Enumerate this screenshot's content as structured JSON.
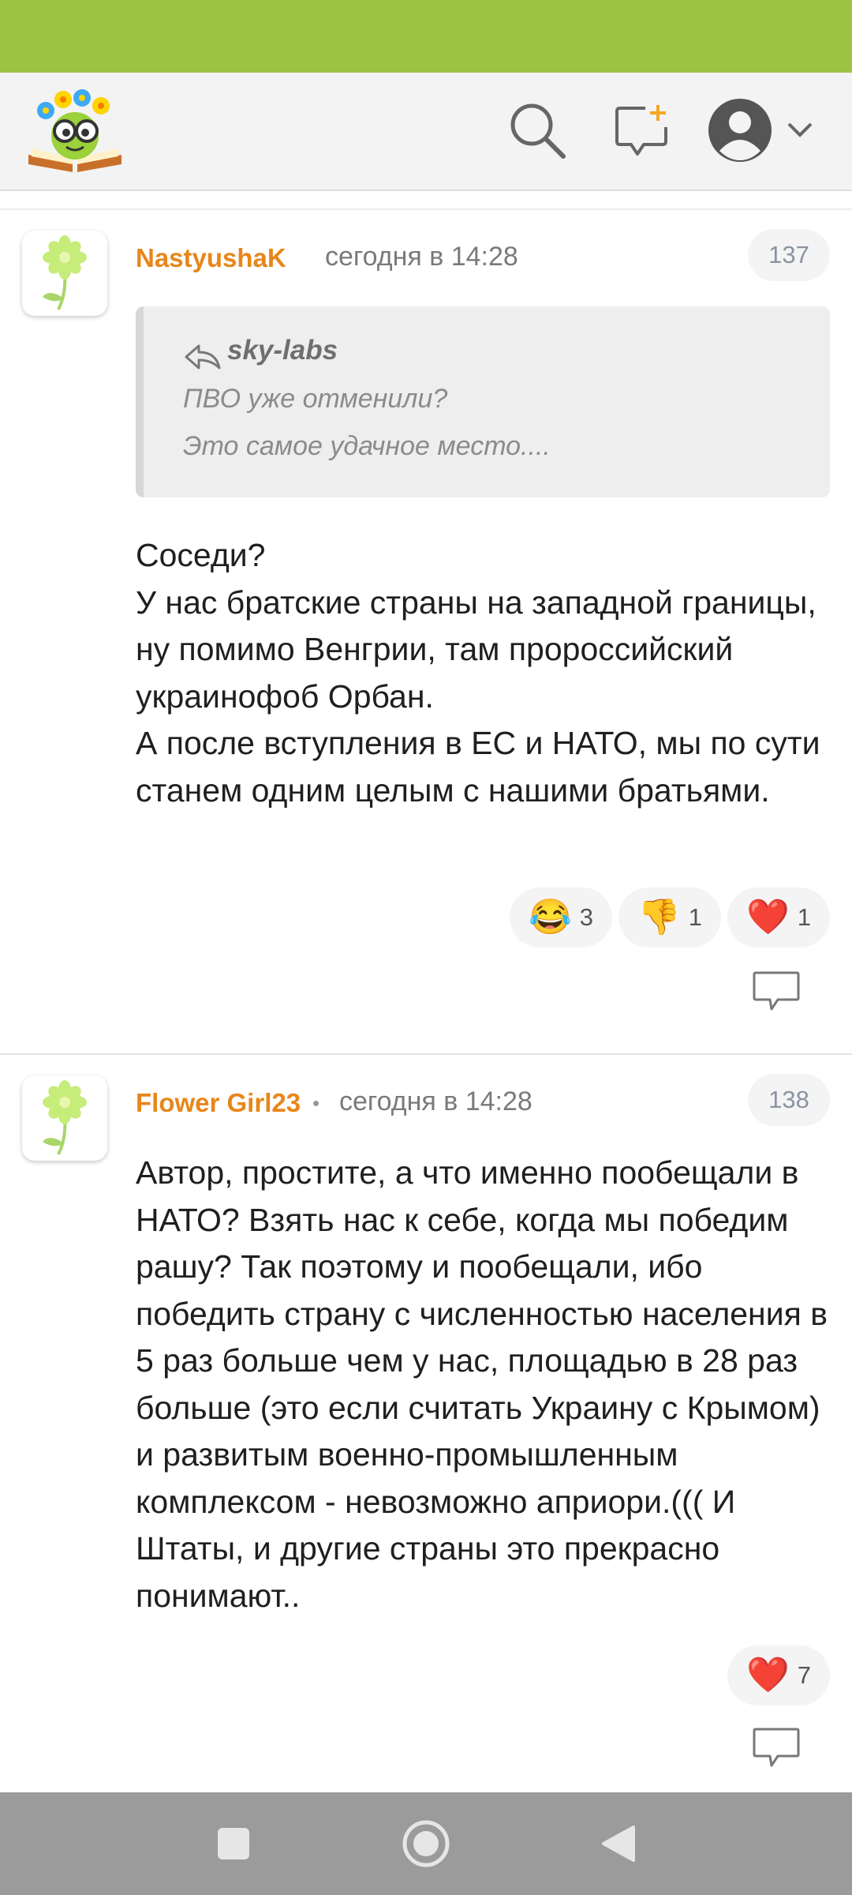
{
  "colors": {
    "status_bar": "#9dc244",
    "author": "#e8861a",
    "nav_bar": "#9b9b9b"
  },
  "header": {
    "logo_icon": "bookworm-logo",
    "search_icon": "search-icon",
    "new_icon": "new-message-icon",
    "profile_icon": "user-avatar-icon"
  },
  "comments": [
    {
      "author": "NastyushaK",
      "time": "сегодня в 14:28",
      "number": "137",
      "quote": {
        "author": "sky-labs",
        "lines": [
          "ПВО уже отменили?",
          "Это самое удачное место...."
        ]
      },
      "text": "Соседи?\nУ нас братские страны на западной границы, ну помимо Венгрии, там пророссийский украинофоб Орбан.\nА после вступления в ЕС и НАТО, мы по сути станем одним целым с нашими братьями.",
      "reactions": [
        {
          "emoji": "😂",
          "count": "3"
        },
        {
          "emoji": "👎",
          "count": "1"
        },
        {
          "emoji": "❤️",
          "count": "1"
        }
      ]
    },
    {
      "author": "Flower Girl23",
      "separator": "•",
      "time": "сегодня в 14:28",
      "number": "138",
      "text": "Автор, простите, а что именно пообещали в НАТО? Взять нас к себе, когда мы победим рашу? Так поэтому и пообещали, ибо победить страну с численностью населения в 5 раз больше чем у нас, площадью в 28 раз больше (это если считать Украину с Крымом) и развитым военно-промышленным комплексом - невозможно априори.((( И Штаты, и другие страны это прекрасно понимают..",
      "reactions": [
        {
          "emoji": "❤️",
          "count": "7"
        }
      ]
    }
  ]
}
